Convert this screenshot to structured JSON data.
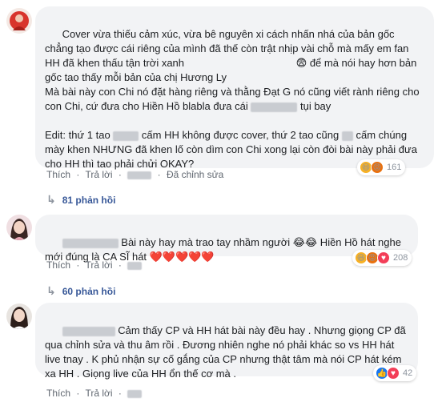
{
  "comments": [
    {
      "text_parts": [
        "Cover vừa thiếu cảm xúc, vừa bê nguyên xi cách nhấn nhá của bản gốc chẳng tạo được cái riêng của mình đã thế còn trật nhịp vài chỗ mà mấy em fan HH đã khen thấu tận trời xanh ",
        " để mà nói hay hơn bản gốc tao thấy mỗi bản của chị Hương Ly\nMà bài này con Chi nó đặt hàng riêng và thằng Đạt G nó cũng viết rành riêng cho con Chi, cứ đưa cho Hiền Hồ blabla đưa cái ",
        " tụi bay\n\nEdit: thứ 1 tao ",
        " cấm HH không được cover, thứ 2 tao cũng ",
        " cấm chúng mày khen NHƯNG đã khen lố còn dìm con Chi xong lại còn đòi bài này phải đưa cho HH thì tao phải chửi OKAY?"
      ],
      "actions": {
        "like": "Thích",
        "reply": "Trả lời",
        "edited": "Đã chỉnh sửa"
      },
      "reaction_count": "161",
      "replies_label": "81 phản hồi"
    },
    {
      "text_parts": [
        " Bài này hay mà trao tay nhầm người ",
        " Hiền Hồ hát nghe mới đúng là CA SĨ hát "
      ],
      "actions": {
        "like": "Thích",
        "reply": "Trả lời"
      },
      "reaction_count": "208",
      "replies_label": "60 phản hồi"
    },
    {
      "text_parts": [
        " Cảm thấy CP và HH hát bài này đều hay . Nhưng giọng CP đã qua chỉnh sửa và thu âm rồi . Đương nhiên nghe nó phải khác so vs HH hát live tnay . K phủ nhận sự cố gắng của CP nhưng thật tâm mà nói CP hát kém xa HH . Giọng live của HH ổn thế cơ mà . "
      ],
      "actions": {
        "like": "Thích",
        "reply": "Trả lời"
      },
      "reaction_count": "42"
    }
  ],
  "colors": {
    "link": "#385898",
    "bubble": "#f2f3f5",
    "meta": "#606770",
    "like_blue": "#1877f2",
    "love_red": "#f33e58",
    "haha_yellow": "#f7b125"
  },
  "icons": [
    "haha-icon",
    "angry-icon",
    "like-icon",
    "love-icon",
    "reply-arrow-icon",
    "crying-laughing-emoji",
    "scared-emoji",
    "red-heart-emoji"
  ]
}
